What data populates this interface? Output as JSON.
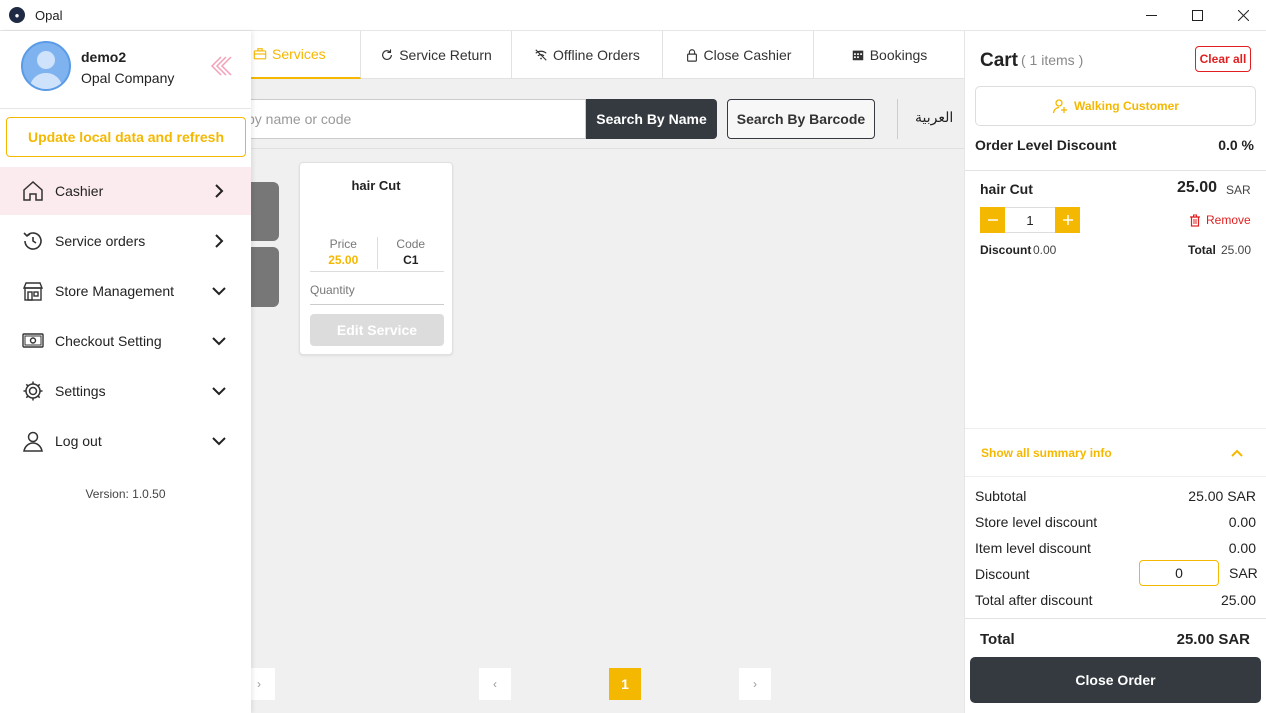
{
  "window": {
    "title": "Opal"
  },
  "tabs": [
    {
      "label": "Services",
      "icon": "briefcase-icon",
      "active": true
    },
    {
      "label": "Service Return",
      "icon": "refresh-icon"
    },
    {
      "label": "Offline Orders",
      "icon": "wifi-off-icon"
    },
    {
      "label": "Close Cashier",
      "icon": "lock-icon"
    },
    {
      "label": "Bookings",
      "icon": "calendar-icon"
    }
  ],
  "search": {
    "placeholder": "by name or code",
    "by_name_label": "Search By Name",
    "by_barcode_label": "Search By Barcode",
    "language_label": "العربية"
  },
  "services": [
    {
      "name": "hair Cut",
      "price_label": "Price",
      "price": "25.00",
      "code_label": "Code",
      "code": "C1",
      "quantity_label": "Quantity",
      "edit_label": "Edit Service"
    }
  ],
  "pagination": {
    "current": "1",
    "prev_symbol": "‹",
    "next_symbol": "›"
  },
  "drawer": {
    "user_name": "demo2",
    "company": "Opal Company",
    "update_label": "Update local data and refresh",
    "nav": [
      {
        "label": "Cashier",
        "icon": "home-icon",
        "chevron": "right",
        "active": true
      },
      {
        "label": "Service orders",
        "icon": "history-icon",
        "chevron": "right"
      },
      {
        "label": "Store Management",
        "icon": "store-icon",
        "chevron": "down"
      },
      {
        "label": "Checkout Setting",
        "icon": "cash-icon",
        "chevron": "down"
      },
      {
        "label": "Settings",
        "icon": "gear-icon",
        "chevron": "down"
      },
      {
        "label": "Log out",
        "icon": "user-icon",
        "chevron": "down"
      }
    ],
    "version": "Version: 1.0.50"
  },
  "cart": {
    "title": "Cart",
    "count_label": "( 1 items )",
    "clear_all_label": "Clear all",
    "customer_label": "Walking Customer",
    "order_discount_label": "Order Level Discount",
    "order_discount_value": "0.0 %",
    "items": [
      {
        "name": "hair Cut",
        "price": "25.00",
        "currency": "SAR",
        "quantity": "1",
        "remove_label": "Remove",
        "discount_label": "Discount",
        "discount_value": "0.00",
        "total_label": "Total",
        "total_value": "25.00"
      }
    ],
    "summary_toggle_label": "Show all summary info",
    "summary": {
      "subtotal_label": "Subtotal",
      "subtotal_value": "25.00 SAR",
      "store_discount_label": "Store level discount",
      "store_discount_value": "0.00",
      "item_discount_label": "Item level discount",
      "item_discount_value": "0.00",
      "discount_label": "Discount",
      "discount_input": "0",
      "discount_currency": "SAR",
      "after_discount_label": "Total after discount",
      "after_discount_value": "25.00"
    },
    "total_label": "Total",
    "total_value": "25.00 SAR",
    "close_order_label": "Close Order"
  },
  "colors": {
    "accent": "#f5b800",
    "dark": "#343a40",
    "danger": "#e02020",
    "active_nav_bg": "#fbeaee"
  }
}
